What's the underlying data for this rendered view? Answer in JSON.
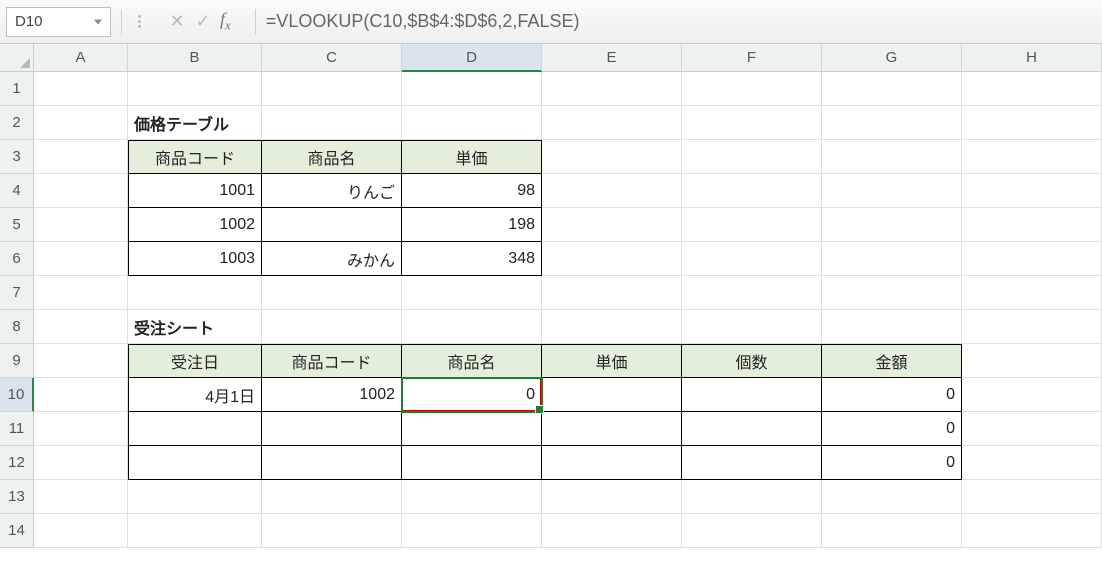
{
  "nameBox": "D10",
  "fx": "fx",
  "formula": "=VLOOKUP(C10,$B$4:$D$6,2,FALSE)",
  "cols": [
    "A",
    "B",
    "C",
    "D",
    "E",
    "F",
    "G",
    "H"
  ],
  "rows": [
    "1",
    "2",
    "3",
    "4",
    "5",
    "6",
    "7",
    "8",
    "9",
    "10",
    "11",
    "12",
    "13",
    "14"
  ],
  "t1": {
    "title": "価格テーブル",
    "h": [
      "商品コード",
      "商品名",
      "単価"
    ],
    "r": [
      [
        "1001",
        "りんご",
        "98"
      ],
      [
        "1002",
        "",
        "198"
      ],
      [
        "1003",
        "みかん",
        "348"
      ]
    ]
  },
  "t2": {
    "title": "受注シート",
    "h": [
      "受注日",
      "商品コード",
      "商品名",
      "単価",
      "個数",
      "金額"
    ],
    "r": [
      [
        "4月1日",
        "1002",
        "0",
        "",
        "",
        "0"
      ],
      [
        "",
        "",
        "",
        "",
        "",
        "0"
      ],
      [
        "",
        "",
        "",
        "",
        "",
        "0"
      ]
    ]
  },
  "chart_data": {
    "type": "table",
    "tables": [
      {
        "name": "価格テーブル",
        "columns": [
          "商品コード",
          "商品名",
          "単価"
        ],
        "rows": [
          [
            1001,
            "りんご",
            98
          ],
          [
            1002,
            "",
            198
          ],
          [
            1003,
            "みかん",
            348
          ]
        ]
      },
      {
        "name": "受注シート",
        "columns": [
          "受注日",
          "商品コード",
          "商品名",
          "単価",
          "個数",
          "金額"
        ],
        "rows": [
          [
            "4月1日",
            1002,
            0,
            null,
            null,
            0
          ],
          [
            null,
            null,
            null,
            null,
            null,
            0
          ],
          [
            null,
            null,
            null,
            null,
            null,
            0
          ]
        ]
      }
    ]
  }
}
